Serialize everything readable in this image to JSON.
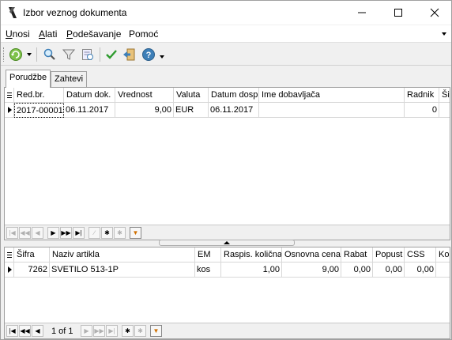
{
  "window": {
    "title": "Izbor veznog dokumenta"
  },
  "menu": {
    "items": [
      {
        "label": "Unosi",
        "hotkey_index": 0
      },
      {
        "label": "Alati",
        "hotkey_index": 0
      },
      {
        "label": "Podešavanje",
        "hotkey_index": 0
      },
      {
        "label": "Pomoć",
        "hotkey_index": 0
      }
    ]
  },
  "toolbar": {
    "icons": [
      "refresh-icon",
      "search-icon",
      "filter-icon",
      "clear-filter-icon",
      "confirm-icon",
      "exit-icon",
      "help-icon"
    ]
  },
  "tabs": [
    {
      "label": "Porudžbe",
      "active": true
    },
    {
      "label": "Zahtevi",
      "active": false
    }
  ],
  "orders_grid": {
    "columns": [
      "Red.br.",
      "Datum dok.",
      "Vrednost",
      "Valuta",
      "Datum dosp",
      "Ime dobavljača",
      "Radnik",
      "Ši"
    ],
    "rows": [
      [
        "2017-00001",
        "06.11.2017",
        "9,00",
        "EUR",
        "06.11.2017",
        "",
        "0",
        ""
      ]
    ]
  },
  "items_grid": {
    "columns": [
      "Šifra",
      "Naziv artikla",
      "EM",
      "Raspis. količna",
      "Osnovna cena",
      "Rabat",
      "Popust",
      "CSS",
      "Kol"
    ],
    "rows": [
      [
        "7262",
        "SVETILO 513-1P",
        "kos",
        "1,00",
        "9,00",
        "0,00",
        "0,00",
        "0,00",
        ""
      ]
    ]
  },
  "bottom_nav": {
    "record_label": "1 of 1"
  },
  "colors": {
    "window_bg": "#f0f0f0",
    "grid_bg": "#ffffff",
    "border": "#a0a0a0"
  }
}
